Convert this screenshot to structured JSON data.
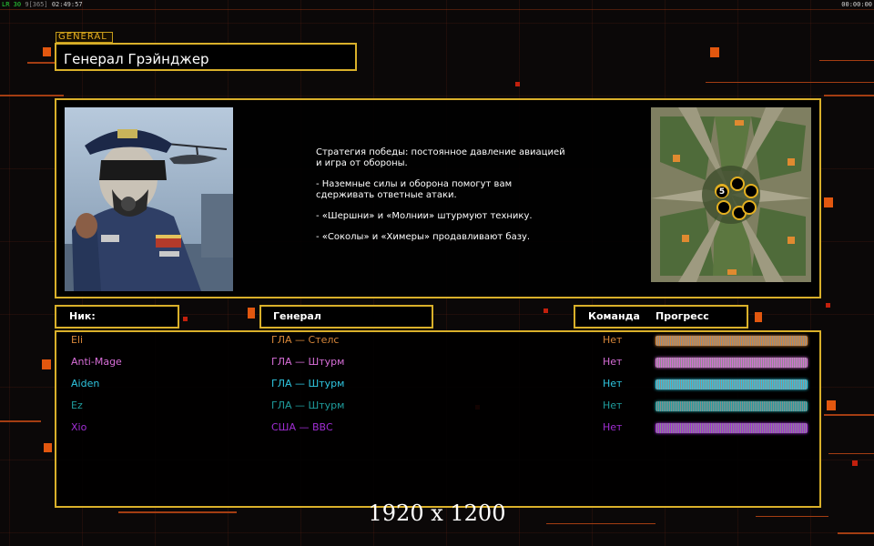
{
  "status_bar": {
    "fps_label": "LR",
    "fps_value": "30",
    "fps_detail": "9[365]",
    "session_time": "02:49:57",
    "right_clock": "00:00:00"
  },
  "general": {
    "tag": "GENERAL",
    "name": "Генерал Грэйнджер"
  },
  "strategy": [
    "Стратегия победы: постоянное давление авиацией\n и игра от обороны.",
    "- Наземные силы и оборона помогут вам\n сдерживать ответные атаки.",
    "- «Шершни» и «Молнии» штурмуют технику.",
    "- «Соколы» и «Химеры» продавливают базу."
  ],
  "map": {
    "player_count": "5"
  },
  "headers": {
    "nick": "Ник:",
    "general": "Генерал",
    "team": "Команда",
    "progress": "Прогресс"
  },
  "players": [
    {
      "name": "Eli",
      "general": "ГЛА — Стелс",
      "team": "Нет",
      "color": "#d9873a",
      "progress": 1.0
    },
    {
      "name": "Anti-Mage",
      "general": "ГЛА — Штурм",
      "team": "Нет",
      "color": "#d86ed8",
      "progress": 1.0
    },
    {
      "name": "Aiden",
      "general": "ГЛА — Штурм",
      "team": "Нет",
      "color": "#2fc6e0",
      "progress": 1.0
    },
    {
      "name": "Ez",
      "general": "ГЛА — Штурм",
      "team": "Нет",
      "color": "#1f9e9e",
      "progress": 1.0
    },
    {
      "name": "Xio",
      "general": "США — ВВС",
      "team": "Нет",
      "color": "#a12ed4",
      "progress": 1.0
    }
  ],
  "resolution_label": "1920 x 1200",
  "colors": {
    "accent_gold": "#d9b02a",
    "accent_orange": "#e2570f",
    "background": "#0b0808"
  }
}
